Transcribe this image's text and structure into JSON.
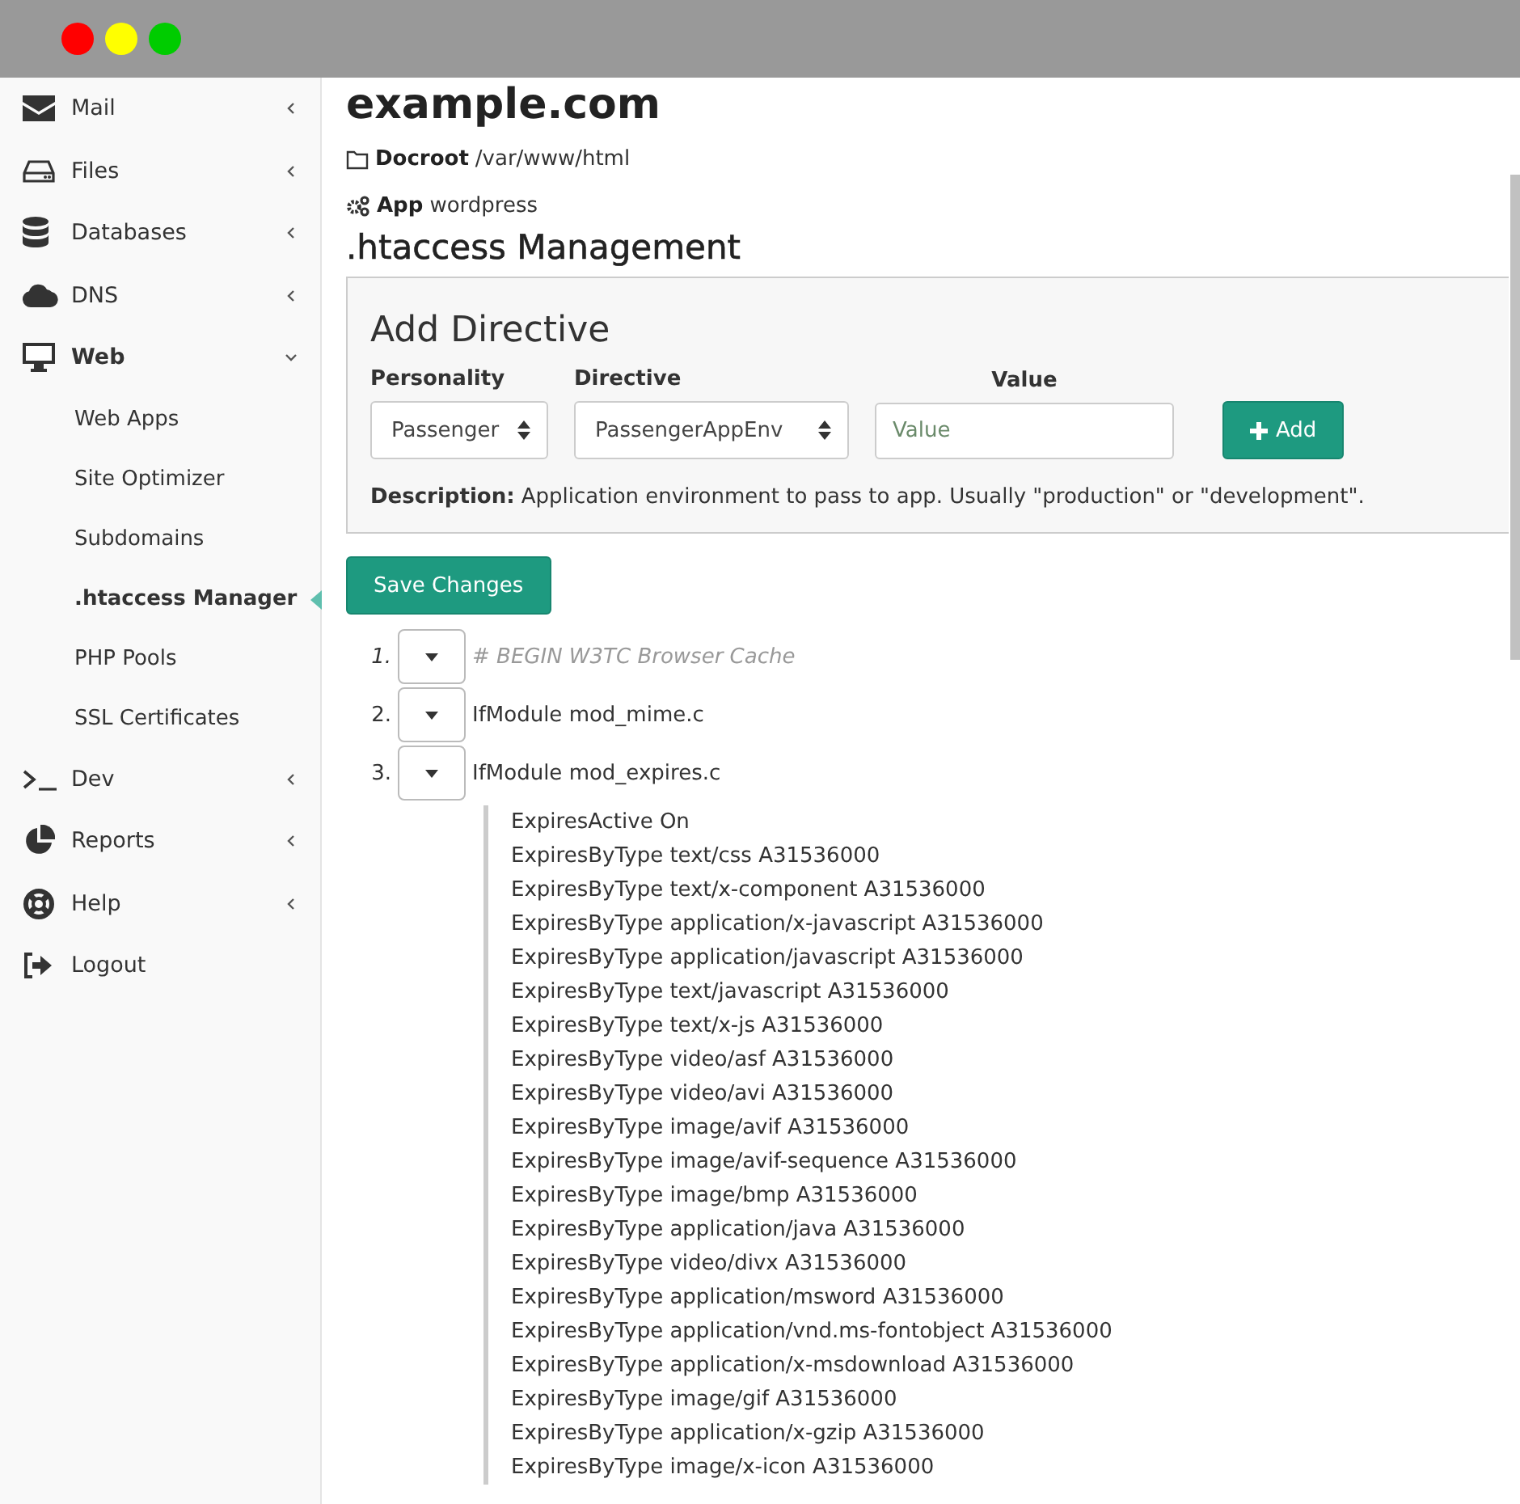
{
  "sidebar": {
    "items": [
      {
        "label": "Mail",
        "expanded": false
      },
      {
        "label": "Files",
        "expanded": false
      },
      {
        "label": "Databases",
        "expanded": false
      },
      {
        "label": "DNS",
        "expanded": false
      },
      {
        "label": "Web",
        "expanded": true,
        "children": [
          {
            "label": "Web Apps",
            "selected": false
          },
          {
            "label": "Site Optimizer",
            "selected": false
          },
          {
            "label": "Subdomains",
            "selected": false
          },
          {
            "label": ".htaccess Manager",
            "selected": true
          },
          {
            "label": "PHP Pools",
            "selected": false
          },
          {
            "label": "SSL Certificates",
            "selected": false
          }
        ]
      },
      {
        "label": "Dev",
        "expanded": false
      },
      {
        "label": "Reports",
        "expanded": false
      },
      {
        "label": "Help",
        "expanded": false
      },
      {
        "label": "Logout"
      }
    ]
  },
  "site": {
    "title": "example.com",
    "docroot_label": "Docroot",
    "docroot": "/var/www/html",
    "app_label": "App",
    "app": "wordpress"
  },
  "section_title": ".htaccess Management",
  "add_directive": {
    "title": "Add Directive",
    "personality": {
      "label": "Personality",
      "value": "Passenger"
    },
    "directive": {
      "label": "Directive",
      "value": "PassengerAppEnv"
    },
    "value": {
      "label": "Value",
      "placeholder": "Value"
    },
    "add_button": "Add",
    "description": "**Description:** Application environment to pass to app. Usually \"production\" or \"development\"."
  },
  "save_button": "Save Changes",
  "rules": [
    {
      "number": "1.",
      "kind": "comment",
      "text": "# BEGIN W3TC Browser Cache"
    },
    {
      "number": "2.",
      "kind": "module",
      "text": "IfModule mod_mime.c"
    },
    {
      "number": "3.",
      "kind": "module",
      "text": "IfModule mod_expires.c",
      "children": [
        "ExpiresActive On",
        "ExpiresByType text/css A31536000",
        "ExpiresByType text/x-component A31536000",
        "ExpiresByType application/x-javascript A31536000",
        "ExpiresByType application/javascript A31536000",
        "ExpiresByType text/javascript A31536000",
        "ExpiresByType text/x-js A31536000",
        "ExpiresByType video/asf A31536000",
        "ExpiresByType video/avi A31536000",
        "ExpiresByType image/avif A31536000",
        "ExpiresByType image/avif-sequence A31536000",
        "ExpiresByType image/bmp A31536000",
        "ExpiresByType application/java A31536000",
        "ExpiresByType video/divx A31536000",
        "ExpiresByType application/msword A31536000",
        "ExpiresByType application/vnd.ms-fontobject A31536000",
        "ExpiresByType application/x-msdownload A31536000",
        "ExpiresByType image/gif A31536000",
        "ExpiresByType application/x-gzip A31536000",
        "ExpiresByType image/x-icon A31536000"
      ]
    }
  ]
}
